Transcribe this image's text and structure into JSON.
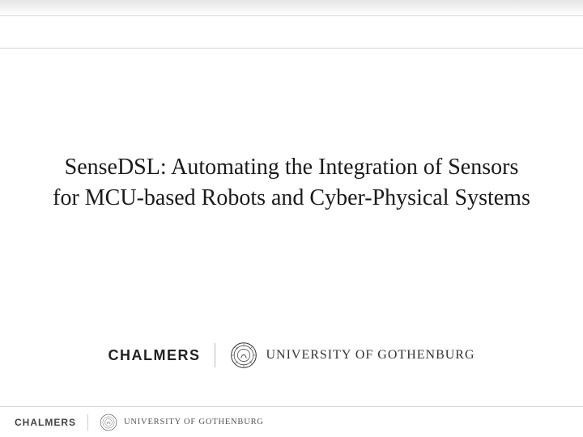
{
  "title": "SenseDSL: Automating the Integration of Sensors for MCU-based Robots and Cyber-Physical Systems",
  "logos": {
    "chalmers": "CHALMERS",
    "gothenburg": "UNIVERSITY OF GOTHENBURG"
  },
  "footer": {
    "chalmers": "CHALMERS",
    "gothenburg": "UNIVERSITY OF GOTHENBURG"
  }
}
